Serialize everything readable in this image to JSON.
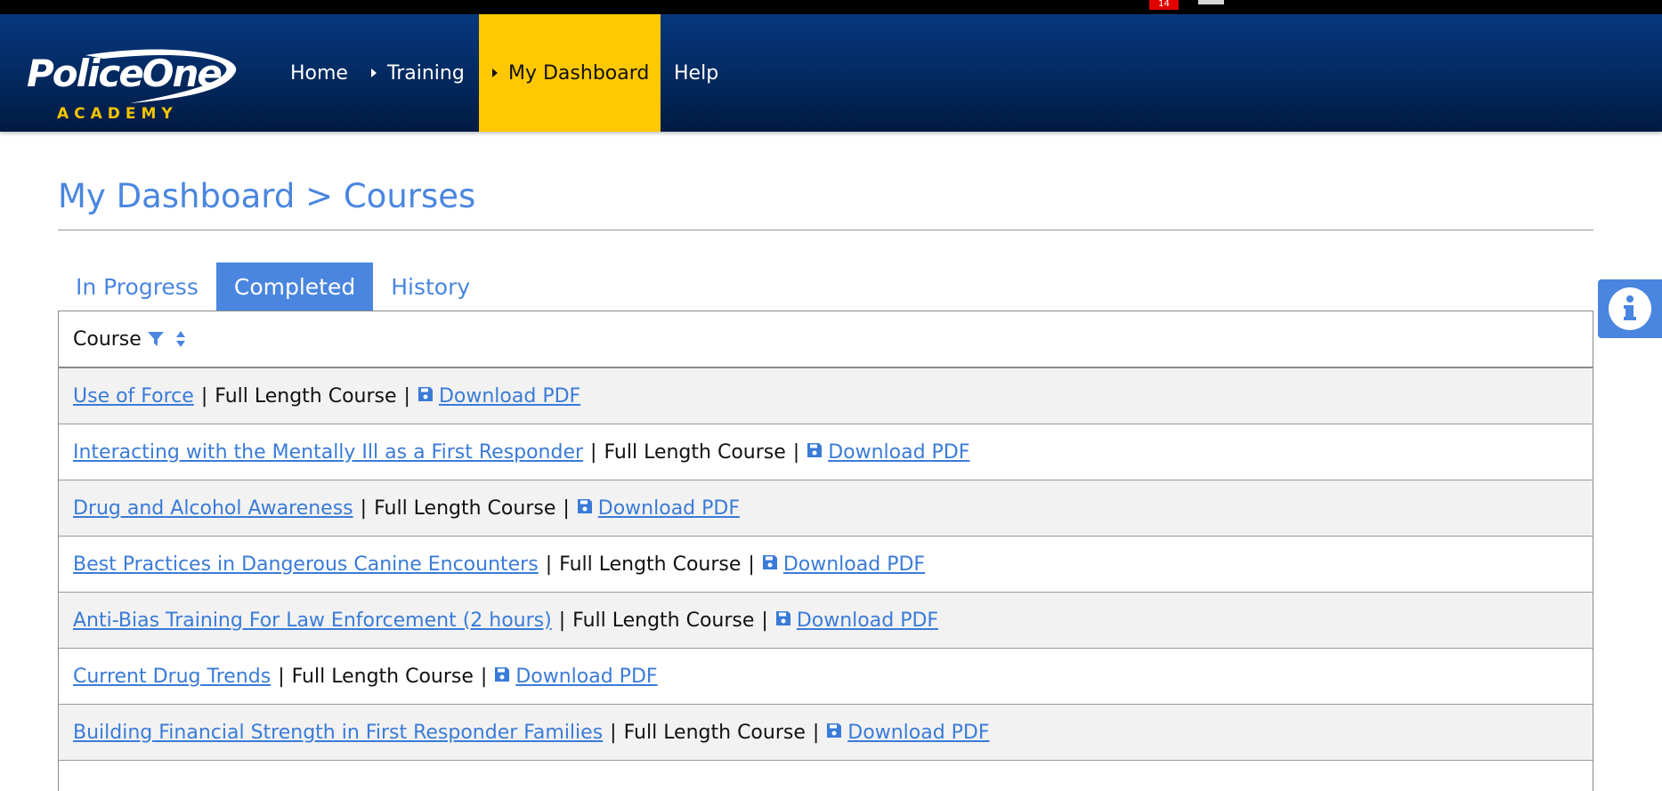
{
  "topbar": {
    "badge_count": "14"
  },
  "logo": {
    "main": "PoliceOne",
    "sub": "ACADEMY"
  },
  "nav": {
    "home": "Home",
    "training": "Training",
    "dashboard": "My Dashboard",
    "help": "Help"
  },
  "page": {
    "title": "My Dashboard > Courses"
  },
  "tabs": [
    "In Progress",
    "Completed",
    "History"
  ],
  "table": {
    "header": "Course",
    "separator": "|",
    "rows": [
      {
        "title": "Use of Force",
        "type": "Full Length Course",
        "action": "Download PDF"
      },
      {
        "title": "Interacting with the Mentally Ill as a First Responder",
        "type": "Full Length Course",
        "action": "Download PDF"
      },
      {
        "title": "Drug and Alcohol Awareness",
        "type": "Full Length Course",
        "action": "Download PDF"
      },
      {
        "title": "Best Practices in Dangerous Canine Encounters",
        "type": "Full Length Course",
        "action": "Download PDF"
      },
      {
        "title": "Anti-Bias Training For Law Enforcement (2 hours)",
        "type": "Full Length Course",
        "action": "Download PDF"
      },
      {
        "title": "Current Drug Trends",
        "type": "Full Length Course",
        "action": "Download PDF"
      },
      {
        "title": "Building Financial Strength in First Responder Families",
        "type": "Full Length Course",
        "action": "Download PDF"
      }
    ]
  },
  "icons": {
    "filter": "filter-icon",
    "sort": "sort-icon",
    "pdf": "save-icon",
    "info": "info-icon"
  },
  "colors": {
    "header_blue": "#03295f",
    "accent_yellow": "#ffc800",
    "link_blue": "#3a7bd8",
    "tab_active": "#4a86e0"
  }
}
